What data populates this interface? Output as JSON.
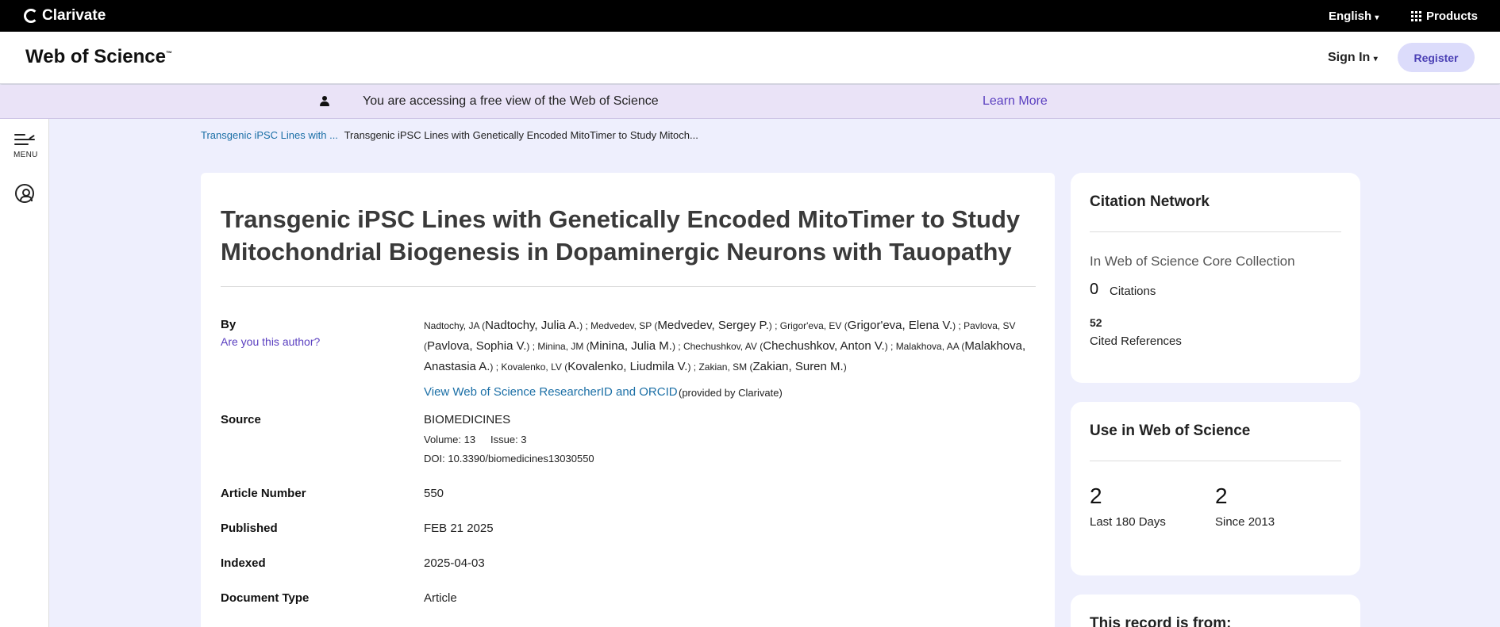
{
  "topbar": {
    "logo": "Clarivate",
    "language": "English",
    "products": "Products"
  },
  "header": {
    "brand": "Web of Science",
    "brand_tm": "™",
    "sign_in": "Sign In",
    "register": "Register"
  },
  "banner": {
    "message": "You are accessing a free view of the Web of Science",
    "learn_more": "Learn More"
  },
  "leftnav": {
    "menu_label": "MENU"
  },
  "breadcrumb": {
    "parent": "Transgenic iPSC Lines with ...",
    "current": "Transgenic iPSC Lines with Genetically Encoded MitoTimer to Study Mitoch..."
  },
  "record": {
    "title": "Transgenic iPSC Lines with Genetically Encoded MitoTimer to Study Mitochondrial Biogenesis in Dopaminergic Neurons with Tauopathy",
    "by_label": "By",
    "are_you_author": "Are you this author?",
    "authors": [
      {
        "short": "Nadtochy, JA",
        "full": "Nadtochy, Julia A."
      },
      {
        "short": "Medvedev, SP",
        "full": "Medvedev, Sergey P."
      },
      {
        "short": "Grigor'eva, EV",
        "full": "Grigor'eva, Elena V."
      },
      {
        "short": "Pavlova, SV",
        "full": "Pavlova, Sophia V."
      },
      {
        "short": "Minina, JM",
        "full": "Minina, Julia M."
      },
      {
        "short": "Chechushkov, AV",
        "full": "Chechushkov, Anton V."
      },
      {
        "short": "Malakhova, AA",
        "full": "Malakhova, Anastasia A."
      },
      {
        "short": "Kovalenko, LV",
        "full": "Kovalenko, Liudmila V."
      },
      {
        "short": "Zakian, SM",
        "full": "Zakian, Suren M."
      }
    ],
    "researcher_link": "View Web of Science ResearcherID and ORCID",
    "provided_by": "(provided by Clarivate)",
    "source_label": "Source",
    "source": "BIOMEDICINES",
    "volume": "Volume: 13",
    "issue": "Issue: 3",
    "doi": "DOI: 10.3390/biomedicines13030550",
    "article_number_label": "Article Number",
    "article_number": "550",
    "published_label": "Published",
    "published": "FEB 21 2025",
    "indexed_label": "Indexed",
    "indexed": "2025-04-03",
    "doc_type_label": "Document Type",
    "doc_type": "Article"
  },
  "citation_network": {
    "title": "Citation Network",
    "collection": "In Web of Science Core Collection",
    "citations_count": "0",
    "citations_label": "Citations",
    "cited_refs_count": "52",
    "cited_refs_label": "Cited References"
  },
  "usage": {
    "title": "Use in Web of Science",
    "last180_count": "2",
    "last180_label": "Last 180 Days",
    "since2013_count": "2",
    "since2013_label": "Since 2013"
  },
  "record_from": {
    "title": "This record is from:"
  }
}
